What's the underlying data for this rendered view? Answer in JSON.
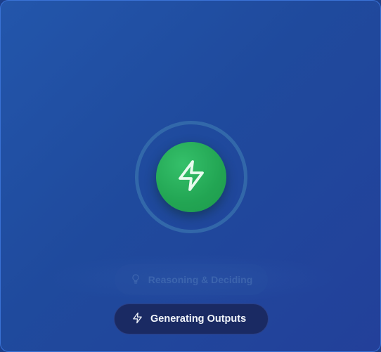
{
  "status": {
    "center_icon": "lightning-bolt-icon",
    "steps": [
      {
        "label": "Reasoning & Deciding",
        "icon": "lightbulb-icon",
        "state": "inactive"
      },
      {
        "label": "Generating Outputs",
        "icon": "lightning-bolt-icon",
        "state": "active"
      }
    ]
  },
  "colors": {
    "background": "#2356ab",
    "orb": "#22a553",
    "active_pill": "#1a2a63"
  }
}
